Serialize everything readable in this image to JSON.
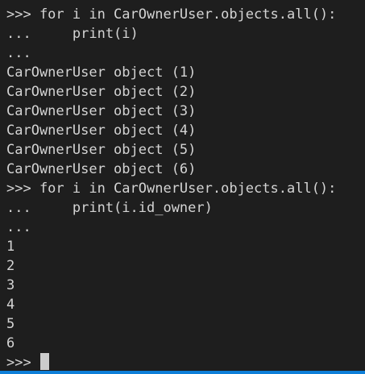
{
  "terminal": {
    "lines": [
      ">>> for i in CarOwnerUser.objects.all():",
      "...     print(i)",
      "...",
      "CarOwnerUser object (1)",
      "CarOwnerUser object (2)",
      "CarOwnerUser object (3)",
      "CarOwnerUser object (4)",
      "CarOwnerUser object (5)",
      "CarOwnerUser object (6)",
      ">>> for i in CarOwnerUser.objects.all():",
      "...     print(i.id_owner)",
      "...",
      "1",
      "2",
      "3",
      "4",
      "5",
      "6"
    ],
    "prompt": ">>> "
  },
  "colors": {
    "background": "#1e1e1e",
    "text": "#d4d4d4",
    "cursor": "#cccccc",
    "status_bar": "#0e7fd8"
  }
}
